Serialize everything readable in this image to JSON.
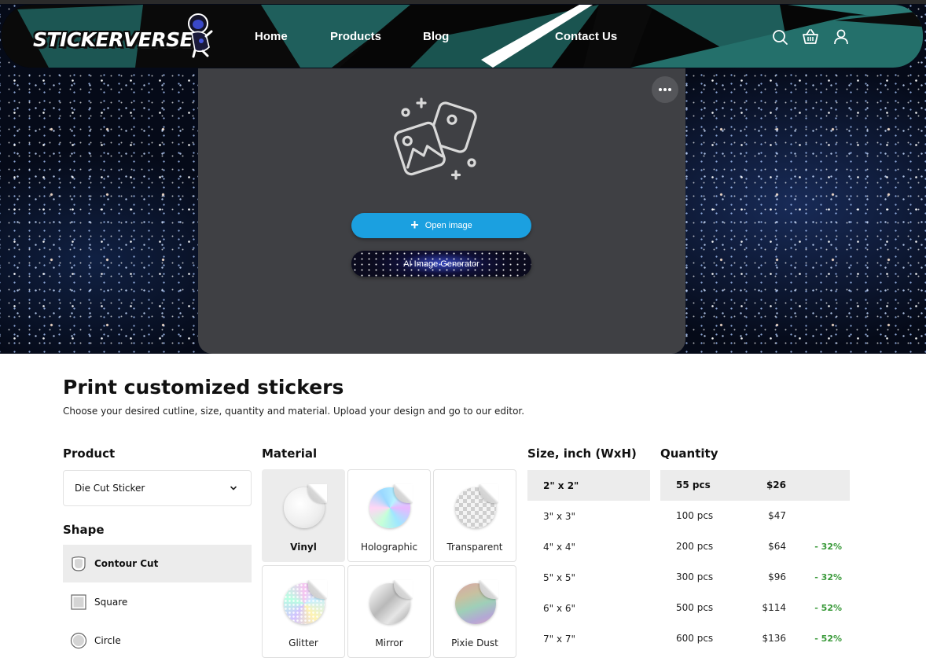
{
  "brand": {
    "logo_text": "STICKERVERSE"
  },
  "nav": {
    "links": [
      "Home",
      "Products",
      "Blog",
      "Contact Us"
    ],
    "icons": [
      "search-icon",
      "basket-icon",
      "user-icon"
    ]
  },
  "editor": {
    "open_image_label": "Open image",
    "ai_generator_label": "AI Image Generator"
  },
  "content": {
    "title": "Print customized stickers",
    "subtitle": "Choose your desired cutline, size, quantity and material. Upload your design and go to our editor."
  },
  "product": {
    "heading": "Product",
    "selected": "Die Cut Sticker"
  },
  "shape": {
    "heading": "Shape",
    "options": [
      {
        "label": "Contour Cut",
        "icon": "contour-cut-icon",
        "selected": true
      },
      {
        "label": "Square",
        "icon": "square-icon",
        "selected": false
      },
      {
        "label": "Circle",
        "icon": "circle-icon",
        "selected": false
      }
    ]
  },
  "material": {
    "heading": "Material",
    "options": [
      {
        "label": "Vinyl",
        "selected": true
      },
      {
        "label": "Holographic",
        "selected": false
      },
      {
        "label": "Transparent",
        "selected": false
      },
      {
        "label": "Glitter",
        "selected": false
      },
      {
        "label": "Mirror",
        "selected": false
      },
      {
        "label": "Pixie Dust",
        "selected": false
      }
    ]
  },
  "size": {
    "heading": "Size, inch (WxH)",
    "options": [
      "2\" x 2\"",
      "3\" x 3\"",
      "4\" x 4\"",
      "5\" x 5\"",
      "6\" x 6\"",
      "7\" x 7\""
    ],
    "selected_index": 0
  },
  "quantity": {
    "heading": "Quantity",
    "options": [
      {
        "pcs": "55 pcs",
        "price": "$26",
        "discount": ""
      },
      {
        "pcs": "100 pcs",
        "price": "$47",
        "discount": ""
      },
      {
        "pcs": "200 pcs",
        "price": "$64",
        "discount": "- 32%"
      },
      {
        "pcs": "300 pcs",
        "price": "$96",
        "discount": "- 32%"
      },
      {
        "pcs": "500 pcs",
        "price": "$114",
        "discount": "- 52%"
      },
      {
        "pcs": "600 pcs",
        "price": "$136",
        "discount": "- 52%"
      }
    ],
    "selected_index": 0
  },
  "colors": {
    "accent_blue": "#1ba0e0",
    "discount_green": "#3a9a3a",
    "nav_teal": "#1f5f5c",
    "editor_bg": "#3f4044"
  }
}
